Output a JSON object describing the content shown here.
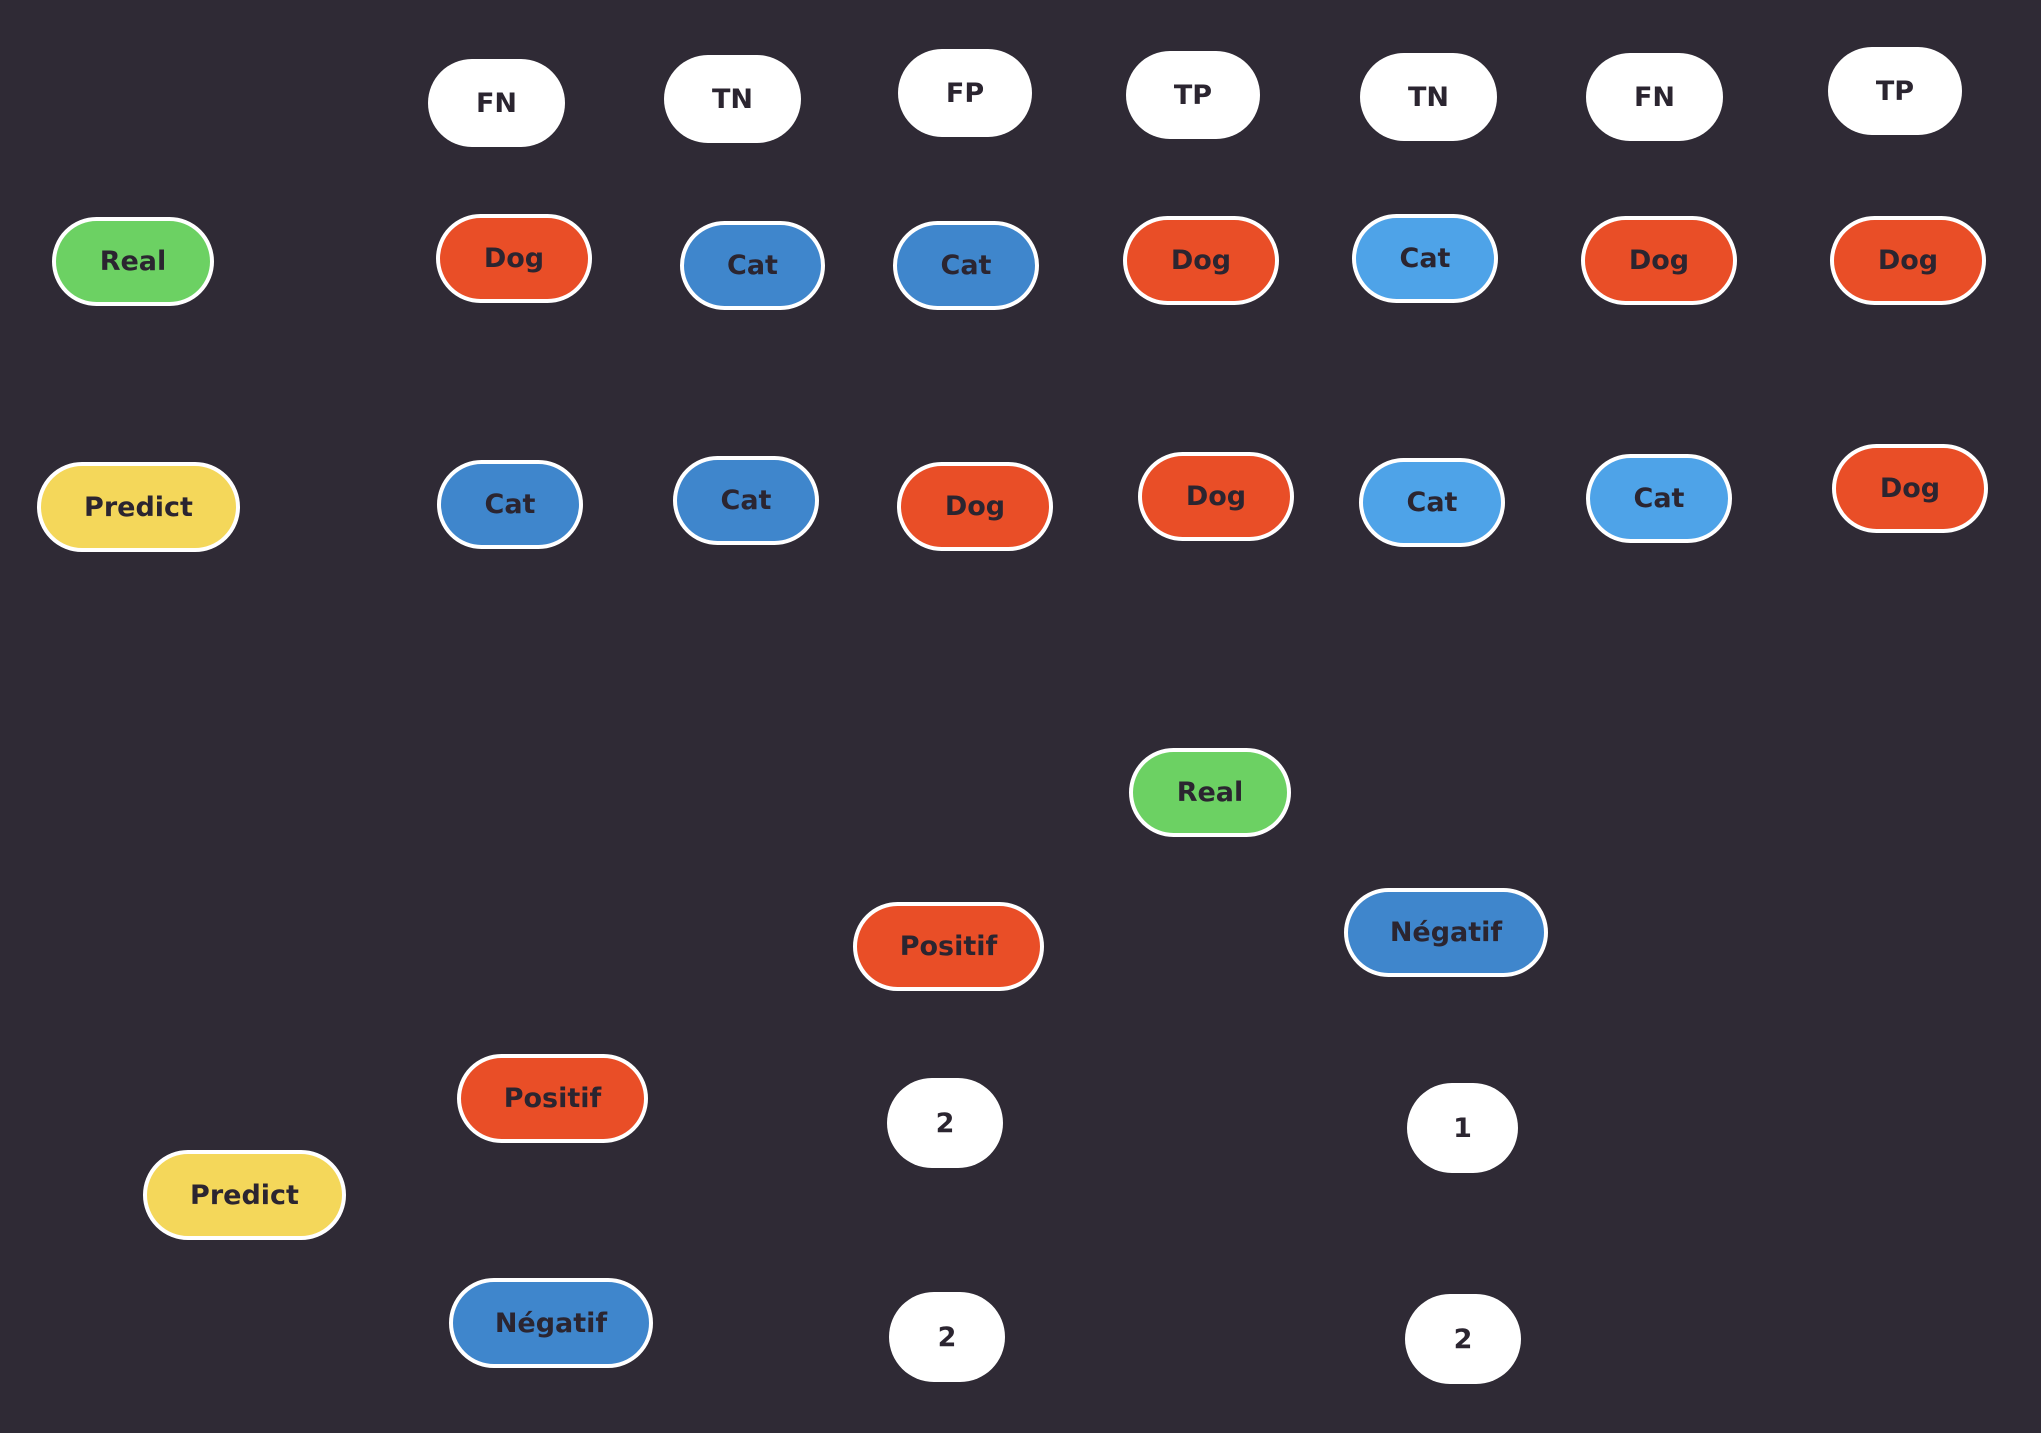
{
  "colors": {
    "background": "#2f2a35",
    "real": "#6cd163",
    "predict": "#f4d75a",
    "dog": "#e94e27",
    "cat_dark": "#3f86cc",
    "cat_light": "#4ea3e8",
    "label": "#ffffff",
    "text": "#2b2530"
  },
  "samples": {
    "outcomes": [
      "FN",
      "TN",
      "FP",
      "TP",
      "TN",
      "FN",
      "TP"
    ],
    "row_labels": {
      "real": "Real",
      "predict": "Predict"
    },
    "real": [
      "Dog",
      "Cat",
      "Cat",
      "Dog",
      "Cat",
      "Dog",
      "Dog"
    ],
    "predict": [
      "Cat",
      "Cat",
      "Dog",
      "Dog",
      "Cat",
      "Cat",
      "Dog"
    ]
  },
  "confusion_matrix": {
    "real_label": "Real",
    "predict_label": "Predict",
    "real_columns": [
      "Positif",
      "Négatif"
    ],
    "predict_rows": [
      "Positif",
      "Négatif"
    ],
    "counts": [
      [
        "2",
        "1"
      ],
      [
        "2",
        "2"
      ]
    ]
  }
}
